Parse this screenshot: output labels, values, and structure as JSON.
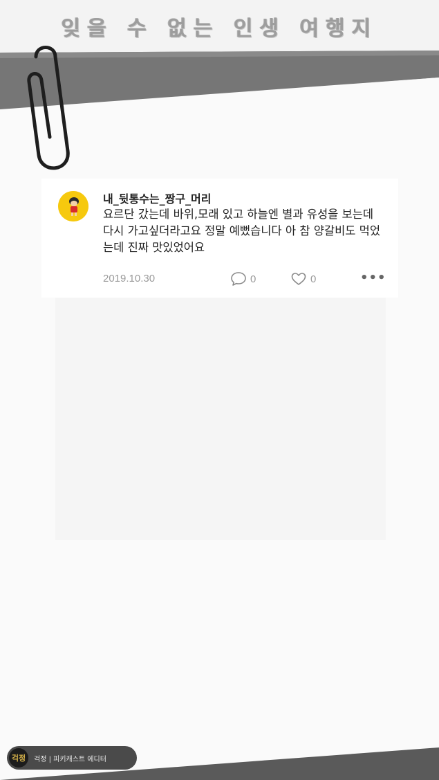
{
  "page": {
    "title": "잊을 수 없는 인생 여행지"
  },
  "post": {
    "username": "내_뒷통수는_짱구_머리",
    "text": "요르단 갔는데 바위,모래 있고 하늘엔 별과 유성을 보는데 다시 가고싶더라고요 정말 예뻤습니다 아 참 양갈비도 먹었는데 진짜 맛있었어요",
    "date": "2019.10.30",
    "comment_count": "0",
    "like_count": "0",
    "more_label": "•••"
  },
  "brand": {
    "logo_text": "걱정",
    "caption": "걱정 | 피키캐스트 에디터"
  },
  "icons": {
    "clip": "paperclip-icon",
    "comment": "comment-icon",
    "like": "heart-icon",
    "more": "more-icon"
  },
  "colors": {
    "gray_band": "#7a7a7a",
    "paper": "#f9f9f9",
    "avatar_bg": "#f6c90e",
    "meta_text": "#9a9a9a"
  }
}
